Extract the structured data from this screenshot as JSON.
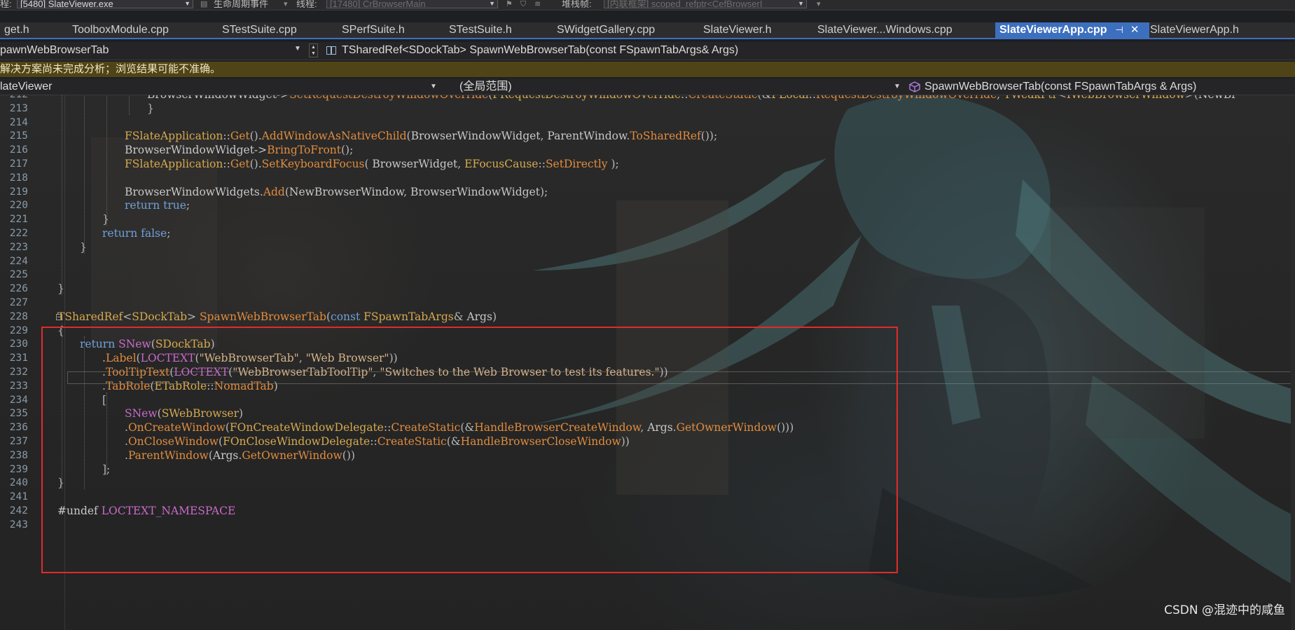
{
  "toolbar": {
    "process_label": "程:",
    "process_value": "[5480] SlateViewer.exe",
    "lifecycle_label": "生命周期事件",
    "thread_label": "线程:",
    "thread_value": "[17480] CrBrowserMain",
    "stack_label": "堆栈帧:",
    "stack_value": "[内联框架] scoped_refptr<CefBrowserI"
  },
  "tabs": [
    {
      "label": "get.h"
    },
    {
      "label": "ToolboxModule.cpp"
    },
    {
      "label": "STestSuite.cpp"
    },
    {
      "label": "SPerfSuite.h"
    },
    {
      "label": "STestSuite.h"
    },
    {
      "label": "SWidgetGallery.cpp"
    },
    {
      "label": "SlateViewer.h"
    },
    {
      "label": "SlateViewer...Windows.cpp"
    },
    {
      "label": "SlateViewerApp.cpp",
      "active": true
    },
    {
      "label": "SlateViewerApp.h"
    }
  ],
  "tab_icons": {
    "pin": "⊣",
    "close": "✕"
  },
  "nav1": {
    "project": "pawnWebBrowserTab",
    "signature": "TSharedRef<SDockTab> SpawnWebBrowserTab(const FSpawnTabArgs& Args)"
  },
  "warning": "解决方案尚未完成分析；浏览结果可能不准确。",
  "nav2": {
    "project": "lateViewer",
    "scope": "(全局范围)",
    "member": "SpawnWebBrowserTab(const FSpawnTabArgs & Args)"
  },
  "code": [
    {
      "n": "212",
      "indent": 210,
      "parts": [
        [
          "def",
          "BrowserWindowWidget->"
        ],
        [
          "fn",
          "SetRequestDestroyWindowOverride"
        ],
        [
          "par",
          "("
        ],
        [
          "typ",
          "FRequestDestroyWindowOverride"
        ],
        [
          "pun",
          "::"
        ],
        [
          "fn",
          "CreateStatic"
        ],
        [
          "par",
          "(&"
        ],
        [
          "typ",
          "FLocal"
        ],
        [
          "pun",
          "::"
        ],
        [
          "fn",
          "RequestDestroyWindowOverride"
        ],
        [
          "par",
          ", "
        ],
        [
          "typ",
          "TWeakPtr"
        ],
        [
          "pun",
          "<"
        ],
        [
          "typ",
          "IWebBrowserWindow"
        ],
        [
          "pun",
          ">("
        ],
        [
          "def",
          "NewBr"
        ]
      ]
    },
    {
      "n": "213",
      "indent": 210,
      "parts": [
        [
          "pun",
          "}"
        ]
      ]
    },
    {
      "n": "214",
      "indent": 0,
      "parts": []
    },
    {
      "n": "215",
      "indent": 178,
      "parts": [
        [
          "typ",
          "FSlateApplication"
        ],
        [
          "pun",
          "::"
        ],
        [
          "fn",
          "Get"
        ],
        [
          "par",
          "()."
        ],
        [
          "fn",
          "AddWindowAsNativeChild"
        ],
        [
          "par",
          "("
        ],
        [
          "def",
          "BrowserWindowWidget"
        ],
        [
          "par",
          ", "
        ],
        [
          "def",
          "ParentWindow"
        ],
        [
          "pun",
          "."
        ],
        [
          "fn",
          "ToSharedRef"
        ],
        [
          "par",
          "());"
        ]
      ]
    },
    {
      "n": "216",
      "indent": 178,
      "parts": [
        [
          "def",
          "BrowserWindowWidget->"
        ],
        [
          "fn",
          "BringToFront"
        ],
        [
          "par",
          "();"
        ]
      ]
    },
    {
      "n": "217",
      "indent": 178,
      "parts": [
        [
          "typ",
          "FSlateApplication"
        ],
        [
          "pun",
          "::"
        ],
        [
          "fn",
          "Get"
        ],
        [
          "par",
          "()."
        ],
        [
          "fn",
          "SetKeyboardFocus"
        ],
        [
          "par",
          "( "
        ],
        [
          "def",
          "BrowserWidget"
        ],
        [
          "par",
          ", "
        ],
        [
          "typ",
          "EFocusCause"
        ],
        [
          "pun",
          "::"
        ],
        [
          "fn",
          "SetDirectly"
        ],
        [
          "par",
          " );"
        ]
      ]
    },
    {
      "n": "218",
      "indent": 0,
      "parts": []
    },
    {
      "n": "219",
      "indent": 178,
      "parts": [
        [
          "def",
          "BrowserWindowWidgets"
        ],
        [
          "pun",
          "."
        ],
        [
          "fn",
          "Add"
        ],
        [
          "par",
          "("
        ],
        [
          "def",
          "NewBrowserWindow"
        ],
        [
          "par",
          ", "
        ],
        [
          "def",
          "BrowserWindowWidget"
        ],
        [
          "par",
          ");"
        ]
      ]
    },
    {
      "n": "220",
      "indent": 178,
      "parts": [
        [
          "kw",
          "return "
        ],
        [
          "kw",
          "true"
        ],
        [
          "pun",
          ";"
        ]
      ]
    },
    {
      "n": "221",
      "indent": 146,
      "parts": [
        [
          "pun",
          "}"
        ]
      ]
    },
    {
      "n": "222",
      "indent": 146,
      "parts": [
        [
          "kw",
          "return "
        ],
        [
          "kw",
          "false"
        ],
        [
          "pun",
          ";"
        ]
      ]
    },
    {
      "n": "223",
      "indent": 114,
      "parts": [
        [
          "pun",
          "}"
        ]
      ]
    },
    {
      "n": "224",
      "indent": 0,
      "parts": []
    },
    {
      "n": "225",
      "indent": 0,
      "parts": []
    },
    {
      "n": "226",
      "indent": 82,
      "parts": [
        [
          "pun",
          "}"
        ]
      ]
    },
    {
      "n": "227",
      "indent": 0,
      "parts": []
    },
    {
      "n": "228",
      "indent": 82,
      "fold": true,
      "parts": [
        [
          "typ",
          "TSharedRef"
        ],
        [
          "pun",
          "<"
        ],
        [
          "typ",
          "SDockTab"
        ],
        [
          "pun",
          "> "
        ],
        [
          "fn",
          "SpawnWebBrowserTab"
        ],
        [
          "par",
          "("
        ],
        [
          "kw",
          "const "
        ],
        [
          "typ",
          "FSpawnTabArgs"
        ],
        [
          "pun",
          "& "
        ],
        [
          "def",
          "Args"
        ],
        [
          "par",
          ")"
        ]
      ]
    },
    {
      "n": "229",
      "indent": 82,
      "parts": [
        [
          "pun",
          "{"
        ]
      ]
    },
    {
      "n": "230",
      "indent": 114,
      "parts": [
        [
          "kw",
          "return "
        ],
        [
          "mac",
          "SNew"
        ],
        [
          "par",
          "("
        ],
        [
          "typ",
          "SDockTab"
        ],
        [
          "par",
          ")"
        ]
      ]
    },
    {
      "n": "231",
      "indent": 146,
      "parts": [
        [
          "pun",
          "."
        ],
        [
          "fn",
          "Label"
        ],
        [
          "par",
          "("
        ],
        [
          "mac",
          "LOCTEXT"
        ],
        [
          "par",
          "("
        ],
        [
          "str",
          "\"WebBrowserTab\""
        ],
        [
          "par",
          ", "
        ],
        [
          "str",
          "\"Web Browser\""
        ],
        [
          "par",
          "))"
        ]
      ]
    },
    {
      "n": "232",
      "indent": 146,
      "parts": [
        [
          "pun",
          "."
        ],
        [
          "fn",
          "ToolTipText"
        ],
        [
          "par",
          "("
        ],
        [
          "mac",
          "LOCTEXT"
        ],
        [
          "par",
          "("
        ],
        [
          "str",
          "\"WebBrowserTabToolTip\""
        ],
        [
          "par",
          ", "
        ],
        [
          "str",
          "\"Switches to the Web Browser to test its features.\""
        ],
        [
          "par",
          "))"
        ]
      ]
    },
    {
      "n": "233",
      "indent": 146,
      "parts": [
        [
          "pun",
          "."
        ],
        [
          "fn",
          "TabRole"
        ],
        [
          "par",
          "("
        ],
        [
          "typ",
          "ETabRole"
        ],
        [
          "pun",
          "::"
        ],
        [
          "fn",
          "NomadTab"
        ],
        [
          "par",
          ")"
        ]
      ]
    },
    {
      "n": "234",
      "indent": 146,
      "parts": [
        [
          "pun",
          "["
        ]
      ]
    },
    {
      "n": "235",
      "indent": 178,
      "parts": [
        [
          "mac",
          "SNew"
        ],
        [
          "par",
          "("
        ],
        [
          "typ",
          "SWebBrowser"
        ],
        [
          "par",
          ")"
        ]
      ]
    },
    {
      "n": "236",
      "indent": 178,
      "parts": [
        [
          "pun",
          "."
        ],
        [
          "fn",
          "OnCreateWindow"
        ],
        [
          "par",
          "("
        ],
        [
          "typ",
          "FOnCreateWindowDelegate"
        ],
        [
          "pun",
          "::"
        ],
        [
          "fn",
          "CreateStatic"
        ],
        [
          "par",
          "(&"
        ],
        [
          "fn",
          "HandleBrowserCreateWindow"
        ],
        [
          "par",
          ", "
        ],
        [
          "def",
          "Args"
        ],
        [
          "pun",
          "."
        ],
        [
          "fn",
          "GetOwnerWindow"
        ],
        [
          "par",
          "()))"
        ]
      ]
    },
    {
      "n": "237",
      "indent": 178,
      "parts": [
        [
          "pun",
          "."
        ],
        [
          "fn",
          "OnCloseWindow"
        ],
        [
          "par",
          "("
        ],
        [
          "typ",
          "FOnCloseWindowDelegate"
        ],
        [
          "pun",
          "::"
        ],
        [
          "fn",
          "CreateStatic"
        ],
        [
          "par",
          "(&"
        ],
        [
          "fn",
          "HandleBrowserCloseWindow"
        ],
        [
          "par",
          "))"
        ]
      ]
    },
    {
      "n": "238",
      "indent": 178,
      "parts": [
        [
          "pun",
          "."
        ],
        [
          "fn",
          "ParentWindow"
        ],
        [
          "par",
          "("
        ],
        [
          "def",
          "Args"
        ],
        [
          "pun",
          "."
        ],
        [
          "fn",
          "GetOwnerWindow"
        ],
        [
          "par",
          "())"
        ]
      ]
    },
    {
      "n": "239",
      "indent": 146,
      "parts": [
        [
          "pun",
          "];"
        ]
      ]
    },
    {
      "n": "240",
      "indent": 82,
      "parts": [
        [
          "pun",
          "}"
        ]
      ]
    },
    {
      "n": "241",
      "indent": 0,
      "parts": []
    },
    {
      "n": "242",
      "indent": 82,
      "parts": [
        [
          "def",
          "#undef "
        ],
        [
          "mac",
          "LOCTEXT_NAMESPACE"
        ]
      ]
    },
    {
      "n": "243",
      "indent": 0,
      "parts": []
    }
  ],
  "fold_glyph": "−",
  "watermark": "CSDN @混迹中的咸鱼"
}
